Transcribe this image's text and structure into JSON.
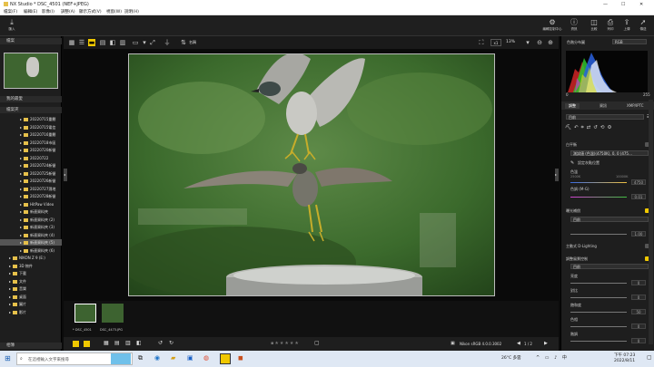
{
  "window": {
    "app": "NX Studio",
    "doc": "* DSC_4501 (NEF+JPEG)"
  },
  "menu": [
    "檔案(F)",
    "編輯(E)",
    "影像(I)",
    "調整(A)",
    "顯示方式(V)",
    "視窗(W)",
    "說明(H)"
  ],
  "toolbar": {
    "import": "匯入",
    "right": [
      "編輯控制中心",
      "資訊",
      "比較",
      "列印",
      "上傳",
      "傳送"
    ]
  },
  "left": {
    "browser": "檔案",
    "favorites": "我的最愛",
    "folders": "檔案夾",
    "tree": [
      "20220715重劃",
      "20220715電信",
      "20220716重劃",
      "20220718市區",
      "20220720新營",
      "20220722",
      "20220724新營",
      "20220725新營",
      "20220726新營",
      "20220727濕地",
      "20220728新營",
      "HitPaw Video",
      "新連資料夾",
      "新連資料夾 (2)",
      "新連資料夾 (3)",
      "新連資料夾 (4)",
      "新連資料夾 (5)",
      "新連資料夾 (6)",
      "NIKON Z 9 (E:)",
      "3D 物件",
      "下載",
      "文件",
      "音樂",
      "桌面",
      "圖片",
      "影片"
    ],
    "bottom": "相簿"
  },
  "viewer": {
    "zoom_mode": "x1",
    "zoom": "13%",
    "sort": "名稱"
  },
  "filmstrip": [
    {
      "name": "* DSC_4501"
    },
    {
      "name": "DSC_4473.JPG"
    }
  ],
  "status": {
    "profile": "Nikon sRGB 4.0.0.3002",
    "page": "1 / 2"
  },
  "right": {
    "hist_title": "色階分布圖",
    "hist_mode": "RGB",
    "hist_min": "0",
    "hist_max": "255",
    "tabs": [
      "調整",
      "資訊",
      "XMP/IPTC"
    ],
    "preset": "目前",
    "wb_title": "白平衡",
    "wb_value": "測試値 (色溫)(4750K), 0, 0 (475…",
    "wb_pick": "設定灰點位置",
    "temp_label": "色溫",
    "temp_min": "2500K",
    "temp_max": "10000K",
    "temp_val": "4750",
    "tint_label": "色調 (M-G)",
    "tint_val": "0.01",
    "exp_title": "曝光補償",
    "exp_sel": "目前",
    "exp_val": "1.00",
    "adl": "主動式 D-Lighting",
    "pc_title": "調整風景控制",
    "pc_sel": "目前",
    "params": [
      {
        "label": "亮度",
        "val": "0"
      },
      {
        "label": "對比",
        "val": "0"
      },
      {
        "label": "飽和度",
        "val": "0"
      },
      {
        "label": "色相",
        "val": "0"
      },
      {
        "label": "階調",
        "val": "0"
      }
    ],
    "mid_val": "50"
  },
  "taskbar": {
    "search": "在這裡輸入文字來搜尋",
    "temp": "26°C 多雲",
    "time": "下午 07:23",
    "date": "2022/8/11"
  }
}
